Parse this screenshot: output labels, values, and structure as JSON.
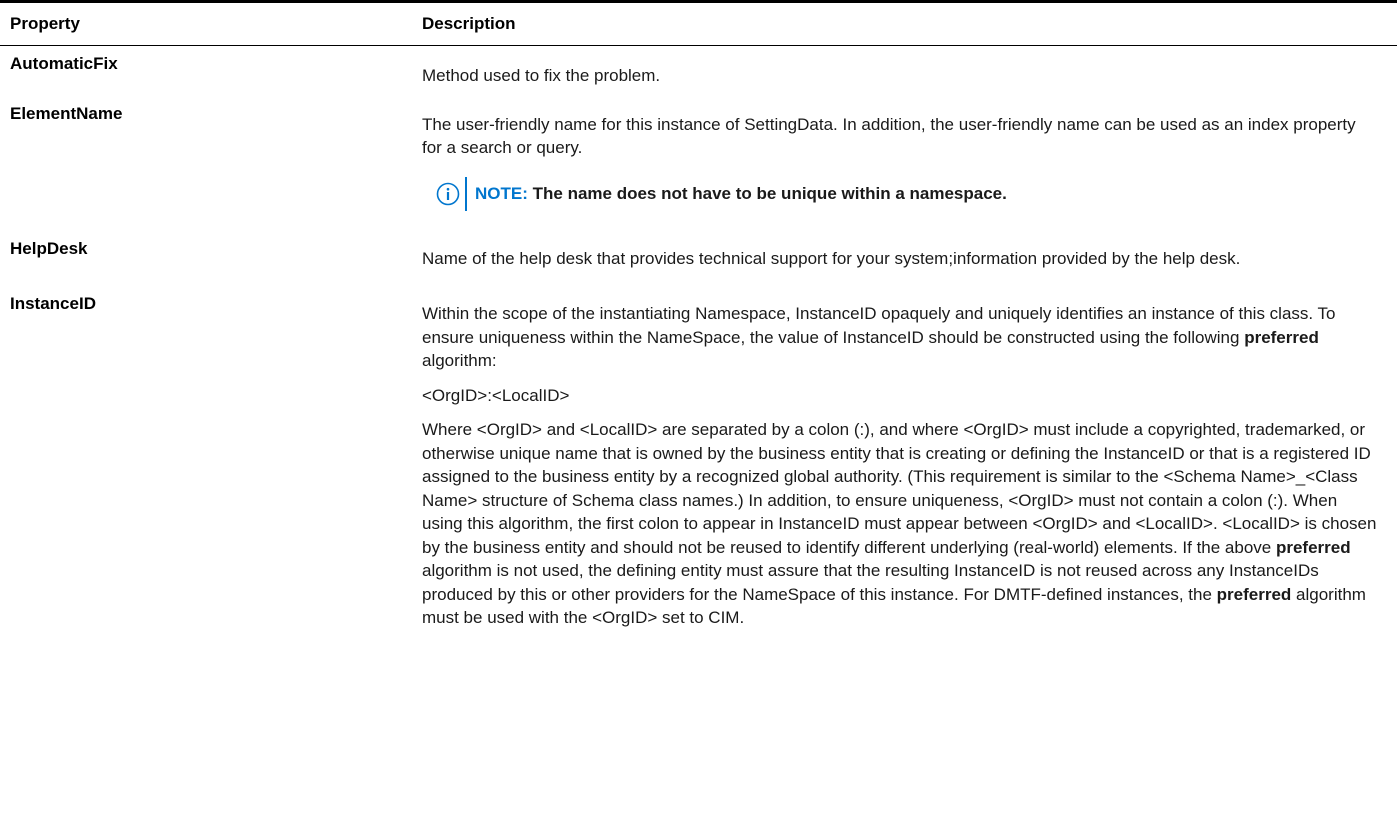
{
  "table": {
    "headers": {
      "property": "Property",
      "description": "Description"
    },
    "rows": [
      {
        "property": "AutomaticFix",
        "description": [
          "Method used to fix the problem."
        ]
      },
      {
        "property": "ElementName",
        "description": [
          "The user-friendly name for this instance of SettingData. In addition, the user-friendly name can be used as an index property for a search or query."
        ],
        "note": {
          "icon": "info-icon",
          "label": "NOTE:",
          "text": "The name does not have to be unique within a namespace."
        }
      },
      {
        "property": "HelpDesk",
        "description": [
          "Name of the help desk that provides technical support for your system;information provided by the help desk."
        ]
      },
      {
        "property": "InstanceID",
        "description": [
          {
            "before": "Within the scope of the instantiating Namespace, InstanceID opaquely and uniquely identifies an instance of this class. To ensure uniqueness within the NameSpace, the value of InstanceID should be constructed using the following ",
            "bold": "preferred",
            "after": " algorithm:"
          },
          "<OrgID>:<LocalID>",
          {
            "seg1": "Where <OrgID> and <LocalID> are separated by a colon (:), and where <OrgID> must include a copyrighted, trademarked, or otherwise unique name that is owned by the business entity that is creating or defining the InstanceID or that is a registered ID assigned to the business entity by a recognized global authority. (This requirement is similar to the <Schema Name>_<Class Name> structure of Schema class names.) In addition, to ensure uniqueness, <OrgID> must not contain a colon (:). When using this algorithm, the first colon to appear in InstanceID must appear between <OrgID> and <LocalID>. <LocalID> is chosen by the business entity and should not be reused to identify different underlying (real-world) elements. If the above ",
            "bold1": "preferred",
            "seg2": " algorithm is not used, the defining entity must assure that the resulting InstanceID is not reused across any InstanceIDs produced by this or other providers for the NameSpace of this instance. For DMTF-defined instances, the ",
            "bold2": "preferred",
            "seg3": " algorithm must be used with the <OrgID> set to CIM."
          }
        ]
      }
    ]
  },
  "colors": {
    "accent": "#0076ce",
    "text": "#1a1a1a",
    "rule": "#000000"
  }
}
